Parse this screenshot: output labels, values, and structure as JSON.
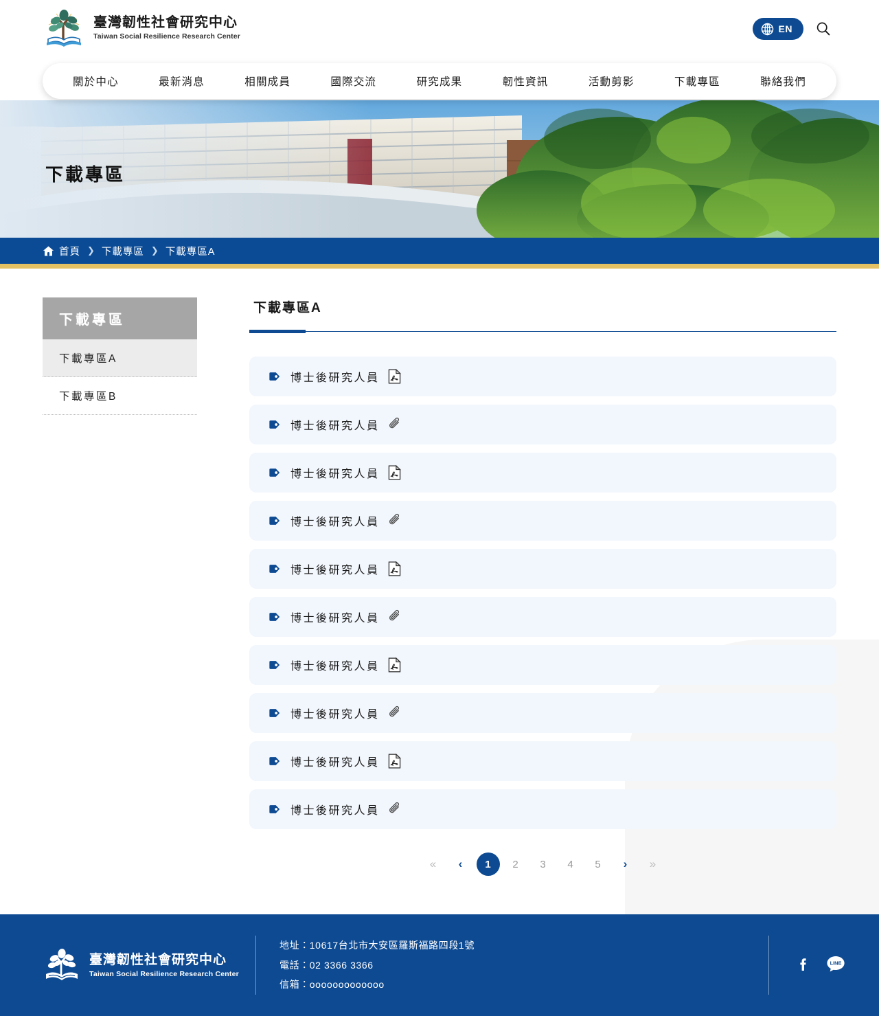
{
  "header": {
    "brand": {
      "zh": "臺灣韌性社會研究中心",
      "en": "Taiwan Social Resilience Research Center",
      "logo_icon": "tree-book-logo-icon"
    },
    "lang_button": {
      "label": "EN",
      "icon": "globe-icon"
    },
    "search_icon": "search-icon",
    "nav": [
      {
        "label": "關於中心"
      },
      {
        "label": "最新消息"
      },
      {
        "label": "相關成員"
      },
      {
        "label": "國際交流"
      },
      {
        "label": "研究成果"
      },
      {
        "label": "韌性資訊"
      },
      {
        "label": "活動剪影"
      },
      {
        "label": "下載專區"
      },
      {
        "label": "聯絡我們"
      }
    ]
  },
  "hero": {
    "title": "下載專區",
    "image_alt": "campus-building-with-trees-banner"
  },
  "breadcrumb": {
    "home_icon": "home-icon",
    "separator": "❯",
    "items": [
      {
        "label": "首頁"
      },
      {
        "label": "下載專區"
      },
      {
        "label": "下載專區A"
      }
    ]
  },
  "sidebar": {
    "heading": "下載專區",
    "items": [
      {
        "label": "下載專區A",
        "active": true
      },
      {
        "label": "下載專區B",
        "active": false
      }
    ]
  },
  "content": {
    "tab": "下載專區A",
    "rows": [
      {
        "title": "博士後研究人員",
        "tag_icon": "tag-icon",
        "file_icon": "pdf-file-icon"
      },
      {
        "title": "博士後研究人員",
        "tag_icon": "tag-icon",
        "file_icon": "paperclip-icon"
      },
      {
        "title": "博士後研究人員",
        "tag_icon": "tag-icon",
        "file_icon": "pdf-file-icon"
      },
      {
        "title": "博士後研究人員",
        "tag_icon": "tag-icon",
        "file_icon": "paperclip-icon"
      },
      {
        "title": "博士後研究人員",
        "tag_icon": "tag-icon",
        "file_icon": "pdf-file-icon"
      },
      {
        "title": "博士後研究人員",
        "tag_icon": "tag-icon",
        "file_icon": "paperclip-icon"
      },
      {
        "title": "博士後研究人員",
        "tag_icon": "tag-icon",
        "file_icon": "pdf-file-icon"
      },
      {
        "title": "博士後研究人員",
        "tag_icon": "tag-icon",
        "file_icon": "paperclip-icon"
      },
      {
        "title": "博士後研究人員",
        "tag_icon": "tag-icon",
        "file_icon": "pdf-file-icon"
      },
      {
        "title": "博士後研究人員",
        "tag_icon": "tag-icon",
        "file_icon": "paperclip-icon"
      }
    ]
  },
  "pagination": {
    "first": "«",
    "prev": "‹",
    "next": "›",
    "last": "»",
    "pages": [
      "1",
      "2",
      "3",
      "4",
      "5"
    ],
    "current": "1"
  },
  "footer": {
    "brand": {
      "zh": "臺灣韌性社會研究中心",
      "en": "Taiwan Social Resilience Research Center",
      "logo_icon": "tree-book-logo-icon"
    },
    "contact": {
      "address": "地址：10617台北市大安區羅斯福路四段1號",
      "phone": "電話：02 3366 3366",
      "email": "信箱：ooooooooooooo"
    },
    "social": [
      {
        "name": "facebook-icon"
      },
      {
        "name": "line-icon"
      }
    ]
  },
  "colors": {
    "brand_blue": "#0d4a92",
    "breadcrumb_blue": "#0b4b96",
    "accent_gold": "#e4c264",
    "row_bg": "#f2f7fd",
    "sidebar_head_gray": "#a6a6a6"
  }
}
